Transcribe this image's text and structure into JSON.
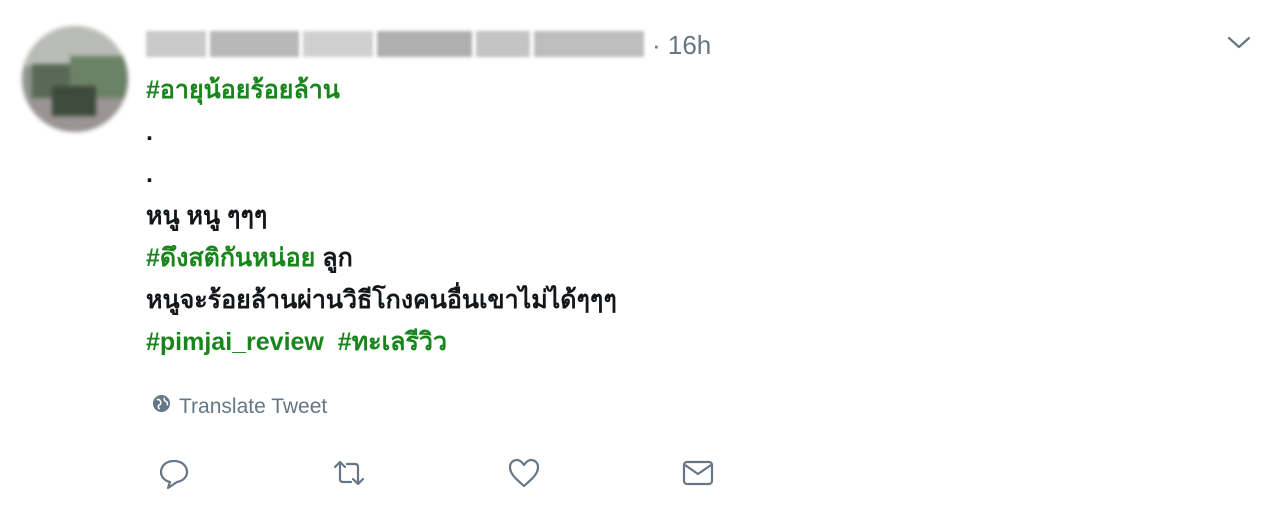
{
  "tweet": {
    "time": "· 16h",
    "lines": [
      {
        "segments": [
          {
            "text": "#อายุน้อยร้อยล้าน",
            "type": "hashtag"
          }
        ]
      },
      {
        "segments": [
          {
            "text": ".",
            "type": "plain"
          }
        ]
      },
      {
        "segments": [
          {
            "text": ".",
            "type": "plain"
          }
        ]
      },
      {
        "segments": [
          {
            "text": "หนู หนู ๆๆๆ",
            "type": "plain"
          }
        ]
      },
      {
        "segments": [
          {
            "text": "#ดึงสติกันหน่อย",
            "type": "hashtag"
          },
          {
            "text": " ลูก",
            "type": "plain"
          }
        ]
      },
      {
        "segments": [
          {
            "text": "หนูจะร้อยล้านผ่านวิธีโกงคนอื่นเขาไม่ได้ๆๆๆ",
            "type": "plain"
          }
        ]
      },
      {
        "segments": [
          {
            "text": "#pimjai_review",
            "type": "hashtag"
          },
          {
            "text": "  ",
            "type": "plain"
          },
          {
            "text": "#ทะเลรีวิว",
            "type": "hashtag"
          }
        ]
      }
    ],
    "translate_label": "Translate Tweet",
    "icons": {
      "menu": "chevron-down-icon",
      "translate": "globe-icon",
      "reply": "reply-icon",
      "retweet": "retweet-icon",
      "like": "heart-icon",
      "dm": "envelope-icon"
    },
    "colors": {
      "hashtag": "#19851c",
      "text": "#14171a",
      "muted": "#657786"
    }
  }
}
